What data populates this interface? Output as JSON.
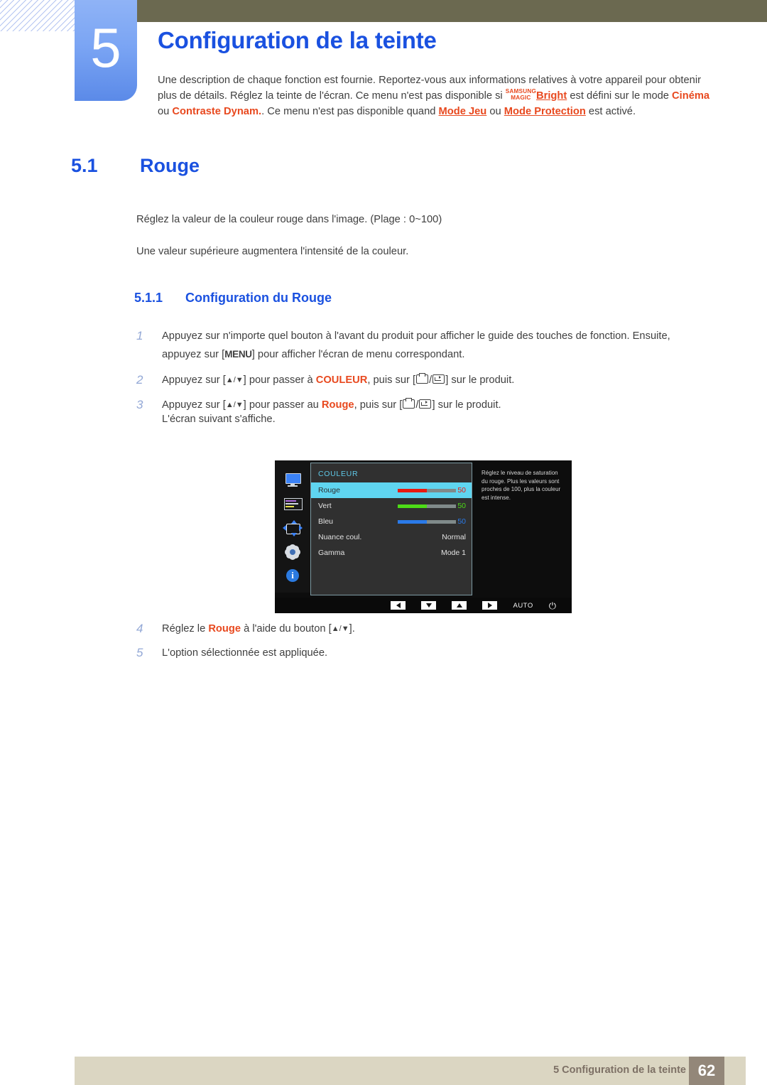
{
  "header": {
    "chapter_number": "5",
    "chapter_title": "Configuration de la teinte",
    "intro_part1": "Une description de chaque fonction est fournie. Reportez-vous aux informations relatives à votre appareil pour obtenir plus de détails. Réglez la teinte de l'écran. Ce menu n'est pas disponible si ",
    "magic_top": "SAMSUNG",
    "magic_bottom": "MAGIC",
    "kw_bright": "Bright",
    "intro_part2": " est défini sur le mode ",
    "kw_cinema": "Cinéma",
    "intro_part3": " ou ",
    "kw_contraste": "Contraste Dynam.",
    "intro_part4": ". Ce menu n'est pas disponible quand ",
    "kw_mode_jeu": "Mode Jeu",
    "intro_part5": " ou ",
    "kw_mode_protection": "Mode Protection",
    "intro_part6": " est activé."
  },
  "section": {
    "number": "5.1",
    "title": "Rouge",
    "paragraph_1": "Réglez la valeur de la couleur rouge dans l'image. (Plage : 0~100)",
    "paragraph_2": "Une valeur supérieure augmentera l'intensité de la couleur."
  },
  "subsection": {
    "number": "5.1.1",
    "title": "Configuration du Rouge"
  },
  "steps": [
    {
      "n": "1",
      "text_a": "Appuyez sur n'importe quel bouton à l'avant du produit pour afficher le guide des touches de fonction. Ensuite, appuyez sur [",
      "key": "MENU",
      "text_b": "] pour afficher l'écran de menu correspondant."
    },
    {
      "n": "2",
      "text_a": "Appuyez sur [",
      "arrows": "▲/▼",
      "text_b": "] pour passer à ",
      "kw": "COULEUR",
      "text_c": ", puis sur [",
      "text_d": "] sur le produit."
    },
    {
      "n": "3",
      "text_a": "Appuyez sur [",
      "arrows": "▲/▼",
      "text_b": "] pour passer au ",
      "kw": "Rouge",
      "text_c": ", puis sur [",
      "text_d": "] sur le produit.",
      "note": "L'écran suivant s'affiche."
    },
    {
      "n": "4",
      "text_a": "Réglez le ",
      "kw": "Rouge",
      "text_b": " à l'aide du bouton [",
      "arrows": "▲/▼",
      "text_c": "]."
    },
    {
      "n": "5",
      "text_a": "L'option sélectionnée est appliquée."
    }
  ],
  "osd": {
    "category": "COULEUR",
    "sidebar_icons": [
      "monitor-icon",
      "color-sliders-icon",
      "position-arrows-icon",
      "gear-icon",
      "info-icon"
    ],
    "rows": [
      {
        "label": "Rouge",
        "value": "50",
        "type": "slider",
        "fill": "#e8190f",
        "selected": true
      },
      {
        "label": "Vert",
        "value": "50",
        "type": "slider",
        "fill": "#4ddb17",
        "selected": false
      },
      {
        "label": "Bleu",
        "value": "50",
        "type": "slider",
        "fill": "#2a7ae8",
        "selected": false
      },
      {
        "label": "Nuance coul.",
        "value": "Normal",
        "type": "text",
        "selected": false
      },
      {
        "label": "Gamma",
        "value": "Mode 1",
        "type": "text",
        "selected": false
      }
    ],
    "help_text": "Réglez le niveau de saturation du rouge. Plus les valeurs sont proches de 100, plus la couleur est intense.",
    "buttons": {
      "left": "◀",
      "down": "▼",
      "up": "▲",
      "right": "▶",
      "auto": "AUTO",
      "power": "⏻"
    }
  },
  "footer": {
    "text": "5 Configuration de la teinte",
    "page": "62"
  },
  "colors": {
    "accent_blue": "#1a51e0",
    "keyword_orange": "#e8491f",
    "olive_bar": "#6b6950",
    "tab_blue": "#7ba5f4",
    "footer_beige": "#dbd6c2",
    "footer_page_box": "#938779",
    "osd_highlight": "#5fd5f0",
    "osd_category": "#5fc9e8"
  }
}
